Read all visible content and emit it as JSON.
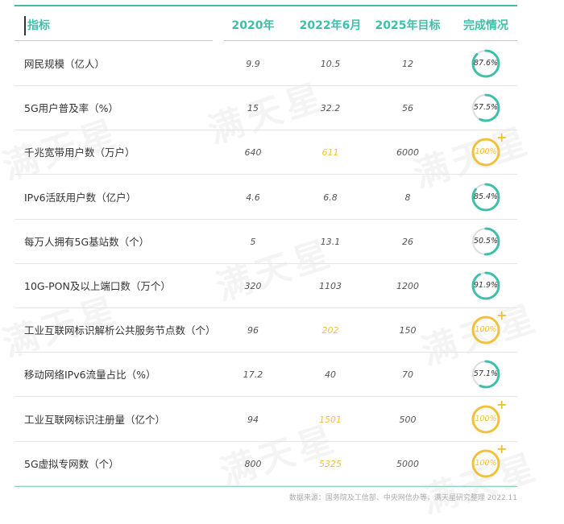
{
  "header": {
    "col_indicator": "指标",
    "col_2020": "2020年",
    "col_2022": "2022年6月",
    "col_2025": "2025年目标",
    "col_status": "完成情况"
  },
  "rows": [
    {
      "name": "网民规模（亿人）",
      "v2020": "9.9",
      "v2022": "10.5",
      "v2025": "12",
      "status": "87.6%",
      "fraction": 0.876,
      "done": false
    },
    {
      "name": "5G用户普及率（%）",
      "v2020": "15",
      "v2022": "32.2",
      "v2025": "56",
      "status": "57.5%",
      "fraction": 0.575,
      "done": false
    },
    {
      "name": "千兆宽带用户数（万户）",
      "v2020": "640",
      "v2022": "611",
      "v2025": "6000",
      "status": "100%",
      "fraction": 1.0,
      "done": true
    },
    {
      "name": "IPv6活跃用户数（亿户）",
      "v2020": "4.6",
      "v2022": "6.8",
      "v2025": "8",
      "status": "85.4%",
      "fraction": 0.854,
      "done": false
    },
    {
      "name": "每万人拥有5G基站数（个）",
      "v2020": "5",
      "v2022": "13.1",
      "v2025": "26",
      "status": "50.5%",
      "fraction": 0.505,
      "done": false
    },
    {
      "name": "10G-PON及以上端口数（万个）",
      "v2020": "320",
      "v2022": "1103",
      "v2025": "1200",
      "status": "91.9%",
      "fraction": 0.919,
      "done": false
    },
    {
      "name": "工业互联网标识解析公共服务节点数（个）",
      "v2020": "96",
      "v2022": "202",
      "v2025": "150",
      "status": "100%",
      "fraction": 1.0,
      "done": true
    },
    {
      "name": "移动网络IPv6流量占比（%）",
      "v2020": "17.2",
      "v2022": "40",
      "v2025": "70",
      "status": "57.1%",
      "fraction": 0.571,
      "done": false
    },
    {
      "name": "工业互联网标识注册量（亿个）",
      "v2020": "94",
      "v2022": "1501",
      "v2025": "500",
      "status": "100%",
      "fraction": 1.0,
      "done": true
    },
    {
      "name": "5G虚拟专网数（个）",
      "v2020": "800",
      "v2022": "5325",
      "v2025": "5000",
      "status": "100%",
      "fraction": 1.0,
      "done": true
    }
  ],
  "footer": {
    "source": "数据来源：国务院及工信部、中央网信办等，满天星研究整理 2022.11"
  },
  "watermark": "满天星",
  "colors": {
    "accent": "#3dbfa9",
    "highlight": "#f2c13c",
    "ring_track": "#dddddd"
  }
}
